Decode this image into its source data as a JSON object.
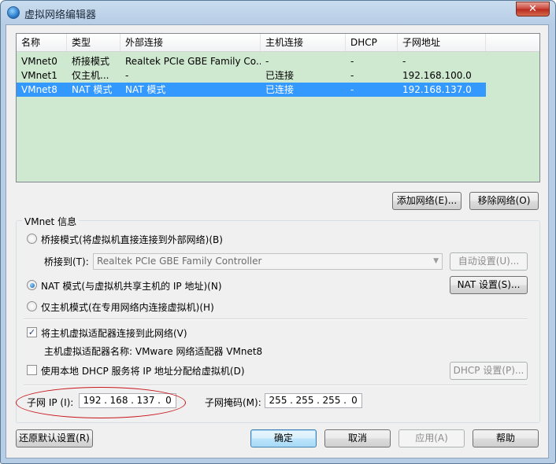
{
  "window": {
    "title": "虚拟网络编辑器",
    "close_label": "✕"
  },
  "table": {
    "columns": [
      "名称",
      "类型",
      "外部连接",
      "主机连接",
      "DHCP",
      "子网地址"
    ],
    "rows": [
      {
        "name": "VMnet0",
        "type": "桥接模式",
        "external": "Realtek PCIe GBE Family Co...",
        "host": "-",
        "dhcp": "-",
        "subnet": "-"
      },
      {
        "name": "VMnet1",
        "type": "仅主机...",
        "external": "-",
        "host": "已连接",
        "dhcp": "-",
        "subnet": "192.168.100.0"
      },
      {
        "name": "VMnet8",
        "type": "NAT 模式",
        "external": "NAT 模式",
        "host": "已连接",
        "dhcp": "-",
        "subnet": "192.168.137.0",
        "selected": true
      }
    ]
  },
  "buttons": {
    "add_network": "添加网络(E)...",
    "remove_network": "移除网络(O)",
    "auto_settings": "自动设置(U)...",
    "nat_settings": "NAT 设置(S)...",
    "dhcp_settings": "DHCP 设置(P)...",
    "restore_defaults": "还原默认设置(R)",
    "ok": "确定",
    "cancel": "取消",
    "apply": "应用(A)",
    "help": "帮助"
  },
  "info": {
    "group_title": "VMnet 信息",
    "bridged_radio": "桥接模式(将虚拟机直接连接到外部网络)(B)",
    "bridged_to_label": "桥接到(T):",
    "bridged_to_value": "Realtek PCIe GBE Family Controller",
    "nat_radio": "NAT 模式(与虚拟机共享主机的 IP 地址)(N)",
    "hostonly_radio": "仅主机模式(在专用网络内连接虚拟机)(H)",
    "connect_adapter_check": "将主机虚拟适配器连接到此网络(V)",
    "adapter_name": "主机虚拟适配器名称: VMware 网络适配器 VMnet8",
    "dhcp_check": "使用本地 DHCP 服务将 IP 地址分配给虚拟机(D)",
    "subnet_ip_label": "子网 IP (I):",
    "subnet_ip": [
      "192",
      "168",
      "137",
      "0"
    ],
    "subnet_mask_label": "子网掩码(M):",
    "subnet_mask": [
      "255",
      "255",
      "255",
      "0"
    ],
    "selected_mode": "nat",
    "connect_adapter_checked": true,
    "dhcp_checked": false
  },
  "colors": {
    "selection": "#3399ff",
    "list_bg": "#cfe8d0",
    "annotation_oval": "#c8141a"
  }
}
